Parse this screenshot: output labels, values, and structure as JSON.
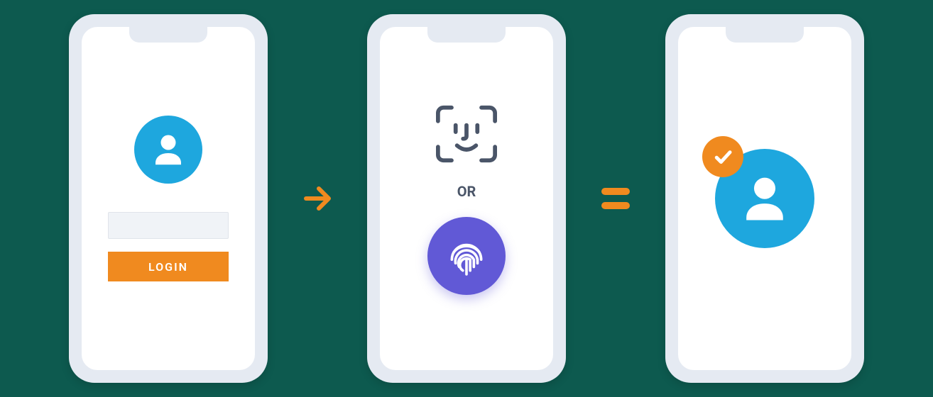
{
  "colors": {
    "background": "#0d5a4f",
    "phone_body": "#e5eaf2",
    "screen": "#ffffff",
    "accent_blue": "#1ea7de",
    "accent_orange": "#f08a1f",
    "accent_purple": "#6159d6",
    "text_muted": "#4a5568"
  },
  "phone1": {
    "login_button_label": "LOGIN"
  },
  "phone2": {
    "divider_label": "OR"
  },
  "connectors": {
    "arrow": "arrow-right",
    "equals": "equals"
  }
}
